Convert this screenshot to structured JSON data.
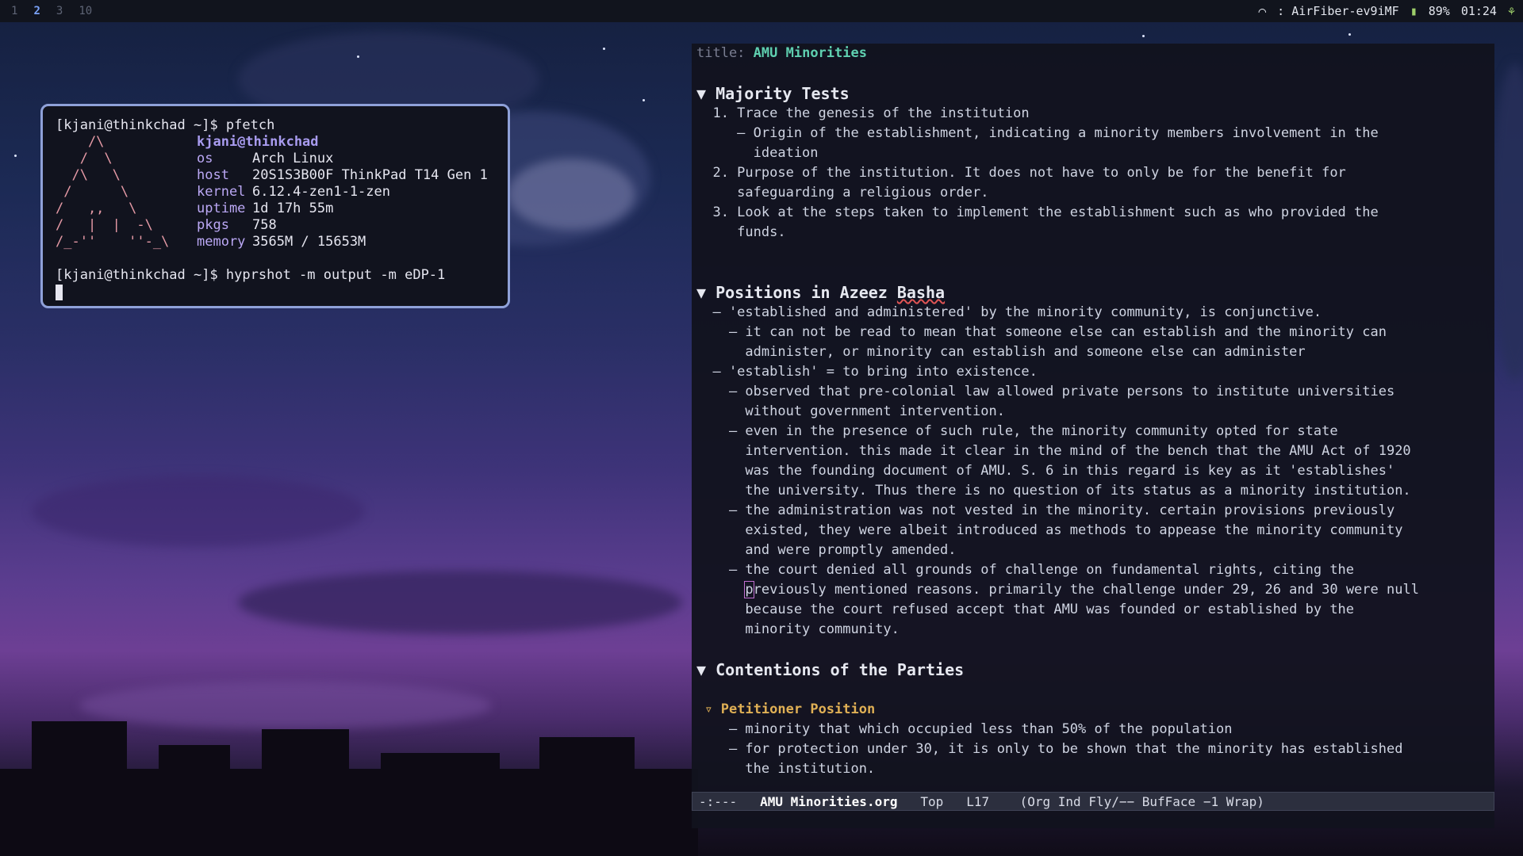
{
  "topbar": {
    "workspaces": [
      "1",
      "2",
      "3",
      "10"
    ],
    "active_workspace": "2",
    "network": ": AirFiber-ev9iMF",
    "battery": "89%",
    "time": "01:24"
  },
  "terminal": {
    "prompt1": "[kjani@thinkchad ~]$ pfetch",
    "logo": [
      "    /\\",
      "   /  \\",
      "  /\\   \\",
      " /      \\",
      "/   ,,   \\",
      "/   |  |  -\\",
      "/_-''    ''-_\\"
    ],
    "user": "kjani@thinkchad",
    "fields": [
      {
        "key": "os",
        "value": "Arch Linux"
      },
      {
        "key": "host",
        "value": "20S1S3B00F ThinkPad T14 Gen 1"
      },
      {
        "key": "kernel",
        "value": "6.12.4-zen1-1-zen"
      },
      {
        "key": "uptime",
        "value": "1d 17h 55m"
      },
      {
        "key": "pkgs",
        "value": "758"
      },
      {
        "key": "memory",
        "value": "3565M / 15653M"
      }
    ],
    "prompt2": "[kjani@thinkchad ~]$ hyprshot -m output -m eDP-1"
  },
  "editor": {
    "title_key": "title:",
    "title_value": "AMU Minorities",
    "sections": {
      "s1": {
        "marker": "▼",
        "heading": "Majority Tests",
        "lines": [
          "  1. Trace the genesis of the institution",
          "     — Origin of the establishment, indicating a minority members involvement in the",
          "       ideation",
          "  2. Purpose of the institution. It does not have to only be for the benefit for",
          "     safeguarding a religious order.",
          "  3. Look at the steps taken to implement the establishment such as who provided the",
          "     funds."
        ]
      },
      "s2": {
        "marker": "▼",
        "heading_a": "Positions in Azeez ",
        "heading_b": "Basha",
        "lines": [
          "  — 'established and administered' by the minority community, is conjunctive.",
          "    — it can not be read to mean that someone else can establish and the minority can",
          "      administer, or minority can establish and someone else can administer",
          "  — 'establish' = to bring into existence.",
          "    — observed that pre-colonial law allowed private persons to institute universities",
          "      without government intervention.",
          "    — even in the presence of such rule, the minority community opted for state",
          "      intervention. this made it clear in the mind of the bench that the AMU Act of 1920",
          "      was the founding document of AMU. S. 6 in this regard is key as it 'establishes'",
          "      the university. Thus there is no question of its status as a minority institution.",
          "    — the administration was not vested in the minority. certain provisions previously",
          "      existed, they were albeit introduced as methods to appease the minority community",
          "      and were promptly amended.",
          "    — the court denied all grounds of challenge on fundamental rights, citing the"
        ],
        "cursor_char": "p",
        "cursor_rest": "reviously mentioned reasons. primarily the challenge under 29, 26 and 30 were null",
        "tail_lines": [
          "      because the court refused accept that AMU was founded or established by the",
          "      minority community."
        ]
      },
      "s3": {
        "marker": "▼",
        "heading": "Contentions of the Parties",
        "sub_marker": "▿",
        "sub_heading": "Petitioner Position",
        "lines": [
          "    — minority that which occupied less than 50% of the population",
          "    — for protection under 30, it is only to be shown that the minority has established",
          "      the institution."
        ]
      }
    },
    "modeline": {
      "state": "-:---",
      "buffer": "AMU Minorities.org",
      "position": "Top",
      "line": "L17",
      "modes": "(Org Ind Fly/−− BufFace −1 Wrap)"
    }
  }
}
